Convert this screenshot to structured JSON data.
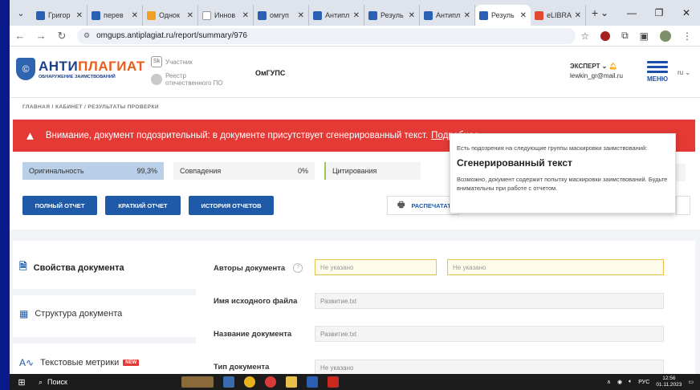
{
  "browser": {
    "tabs": [
      {
        "label": "Григор",
        "color": "#2b5fb4"
      },
      {
        "label": "перев",
        "color": "#2b5fb4"
      },
      {
        "label": "Однок",
        "color": "#f2a024"
      },
      {
        "label": "Иннов",
        "color": "#ffffff"
      },
      {
        "label": "омгуп",
        "color": "#2b5fb4"
      },
      {
        "label": "Антипл",
        "color": "#2b5fb4"
      },
      {
        "label": "Резуль",
        "color": "#2b5fb4"
      },
      {
        "label": "Антипл",
        "color": "#2b5fb4"
      },
      {
        "label": "Резуль",
        "color": "#2b5fb4",
        "active": true
      },
      {
        "label": "eLIBRA",
        "color": "#e04a2f"
      }
    ],
    "close_glyph": "✕",
    "new_tab_glyph": "+",
    "url": "omgups.antiplagiat.ru/report/summary/976"
  },
  "header": {
    "logo_main_1": "АНТИ",
    "logo_main_2": "ПЛАГИАТ",
    "logo_sub": "ОБНАРУЖЕНИЕ ЗАИМСТВОВАНИЙ",
    "sk_badge": "Sk",
    "sk_label": "Участник",
    "registry_label_1": "Реестр",
    "registry_label_2": "отечественного ПО",
    "org": "ОмГУПС",
    "user_role": "ЭКСПЕРТ",
    "user_email": "lewkin_gr@mail.ru",
    "menu_label": "МЕНЮ",
    "lang": "ru"
  },
  "breadcrumb": "ГЛАВНАЯ / КАБИНЕТ / РЕЗУЛЬТАТЫ ПРОВЕРКИ",
  "alert": {
    "text": "Внимание, документ подозрительный: в документе присутствует сгенерированный текст.",
    "link": "Подробнее"
  },
  "stats": {
    "originality_label": "Оригинальность",
    "originality_value": "99,3%",
    "matches_label": "Совпадения",
    "matches_value": "0%",
    "citations_label": "Цитирования"
  },
  "tooltip": {
    "intro": "Есть подозрения на следующие группы маскировки заимствований:",
    "title": "Сгенерированный текст",
    "body": "Возможно, документ содержит попытку маскировки заимствований. Будьте внимательны при работе с отчетом."
  },
  "buttons": {
    "full": "ПОЛНЫЙ ОТЧЕТ",
    "short": "КРАТКИЙ ОТЧЕТ",
    "history": "ИСТОРИЯ ОТЧЕТОВ",
    "print": "РАСПЕЧАТАТ"
  },
  "sidebar": {
    "properties": "Свойства документа",
    "structure": "Структура документа",
    "metrics": "Текстовые метрики",
    "new_badge": "NEW"
  },
  "form": {
    "authors_label": "Авторы документа",
    "authors_value_1": "Не указано",
    "authors_value_2": "Не указано",
    "source_file_label": "Имя исходного файла",
    "source_file_value": "Развитие.txt",
    "doc_name_label": "Название документа",
    "doc_name_value": "Развитие.txt",
    "doc_type_label": "Тип документа",
    "doc_type_value": "Не указано"
  },
  "taskbar": {
    "search": "Поиск",
    "lang": "РУС",
    "time": "12:56",
    "date": "01.11.2023"
  }
}
